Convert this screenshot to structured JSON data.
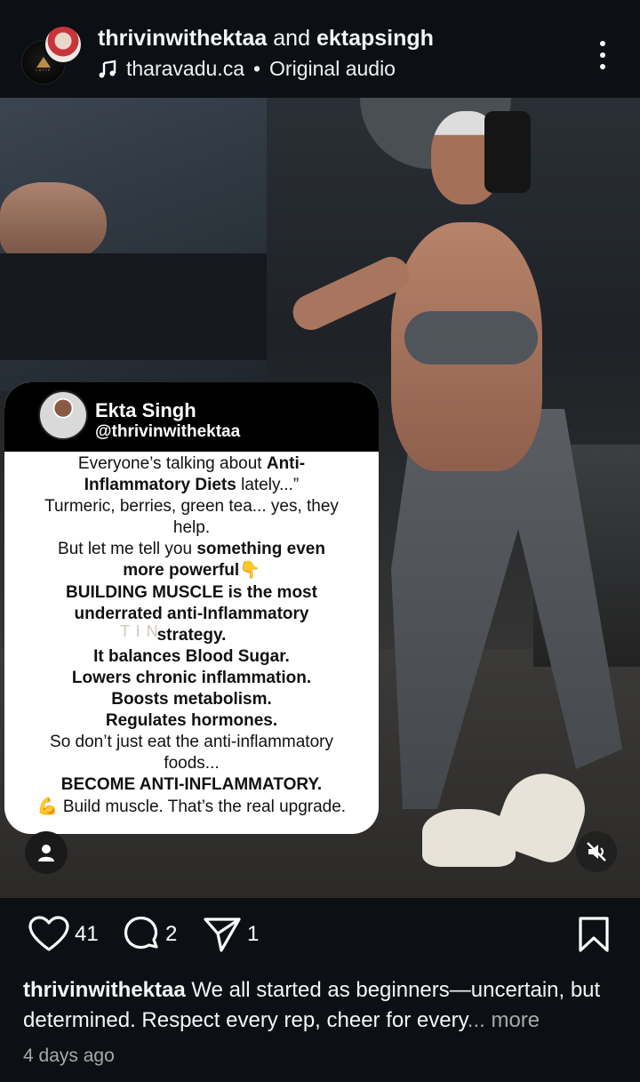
{
  "header": {
    "user_primary": "thrivinwithektaa",
    "and_text": "and",
    "user_secondary": "ektapsingh",
    "audio_source": "tharavadu.ca",
    "audio_separator": "•",
    "audio_label": "Original audio",
    "logo_text": "LATTE"
  },
  "overlay_card": {
    "name": "Ekta Singh",
    "handle": "@thrivinwithektaa",
    "watermark": "T               I N",
    "lines": [
      {
        "pre": "Everyone’s talking about ",
        "bold": "Anti-",
        "post": ""
      },
      {
        "pre": "",
        "bold": "Inflammatory Diets",
        "post": " lately...”"
      },
      {
        "pre": "Turmeric, berries, green tea... yes, they",
        "bold": "",
        "post": ""
      },
      {
        "pre": "help.",
        "bold": "",
        "post": ""
      },
      {
        "pre": "But let me tell you ",
        "bold": "something even",
        "post": ""
      },
      {
        "pre": "",
        "bold": "more powerful",
        "post": "👇"
      },
      {
        "pre": "",
        "bold": "BUILDING MUSCLE is the most",
        "post": ""
      },
      {
        "pre": "",
        "bold": "underrated anti-Inflammatory",
        "post": ""
      },
      {
        "pre": "",
        "bold": "strategy.",
        "post": ""
      },
      {
        "pre": "",
        "bold": "It balances Blood Sugar.",
        "post": ""
      },
      {
        "pre": "",
        "bold": "Lowers chronic inflammation.",
        "post": ""
      },
      {
        "pre": "",
        "bold": "Boosts metabolism.",
        "post": ""
      },
      {
        "pre": "",
        "bold": "Regulates hormones.",
        "post": ""
      },
      {
        "pre": "So don’t just eat the anti-inflammatory",
        "bold": "",
        "post": ""
      },
      {
        "pre": "foods...",
        "bold": "",
        "post": ""
      },
      {
        "pre": "",
        "bold": "BECOME ANTI-INFLAMMATORY.",
        "post": ""
      },
      {
        "pre": "💪 Build muscle. That’s the real upgrade.",
        "bold": "",
        "post": ""
      }
    ]
  },
  "actions": {
    "likes": "41",
    "comments": "2",
    "shares": "1"
  },
  "caption": {
    "username": "thrivinwithektaa",
    "text": " We all started as beginners—uncertain, but determined. Respect every rep, cheer for every",
    "ellipsis": "...",
    "more": " more"
  },
  "timestamp": "4 days ago",
  "colors": {
    "background": "#0c1014",
    "text": "#f5f5f5",
    "muted": "#a8a8a8"
  }
}
